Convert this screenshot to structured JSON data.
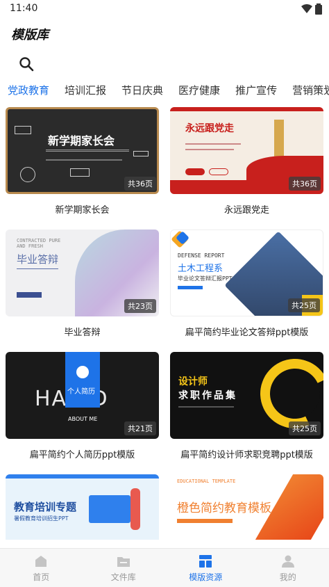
{
  "status": {
    "time": "11:40"
  },
  "header": {
    "title": "模版库"
  },
  "tabs": [
    {
      "label": "党政教育",
      "active": true
    },
    {
      "label": "培训汇报"
    },
    {
      "label": "节日庆典"
    },
    {
      "label": "医疗健康"
    },
    {
      "label": "推广宣传"
    },
    {
      "label": "营销策划"
    }
  ],
  "cards": [
    {
      "caption": "新学期家长会",
      "pages": "共36页",
      "thumb_title": "新学期家长会"
    },
    {
      "caption": "永远跟党走",
      "pages": "共36页",
      "thumb_title": "永远跟党走"
    },
    {
      "caption": "毕业答辩",
      "pages": "共23页",
      "thumb_title": "毕业答辩",
      "thumb_sub": "CONTRACTED PURE AND FRESH"
    },
    {
      "caption": "扁平简约毕业论文答辩ppt模版",
      "pages": "共25页",
      "thumb_title": "土木工程系",
      "thumb_sub": "DEFENSE REPORT",
      "thumb_sub2": "毕业论文答辩汇报PPT"
    },
    {
      "caption": "扁平简约个人简历ppt模版",
      "pages": "共21页",
      "thumb_title": "个人简历",
      "thumb_sub": "ABOUT ME",
      "thumb_big": "HA  RD"
    },
    {
      "caption": "扁平简约设计师求职竞聘ppt模版",
      "pages": "共25页",
      "thumb_title": "设计师",
      "thumb_sub": "求职作品集"
    },
    {
      "caption": "",
      "pages": "",
      "thumb_title": "教育培训专题",
      "thumb_sub": "暑假教育培训招生PPT"
    },
    {
      "caption": "",
      "pages": "",
      "thumb_title": "橙色简约教育模板",
      "thumb_sub": "EDUCATIONAL TEMPLATE"
    }
  ],
  "nav": [
    {
      "label": "首页",
      "icon": "home-icon"
    },
    {
      "label": "文件库",
      "icon": "folder-icon"
    },
    {
      "label": "模版资源",
      "icon": "template-icon",
      "active": true
    },
    {
      "label": "我的",
      "icon": "user-icon"
    }
  ],
  "colors": {
    "accent": "#1e73e8"
  }
}
